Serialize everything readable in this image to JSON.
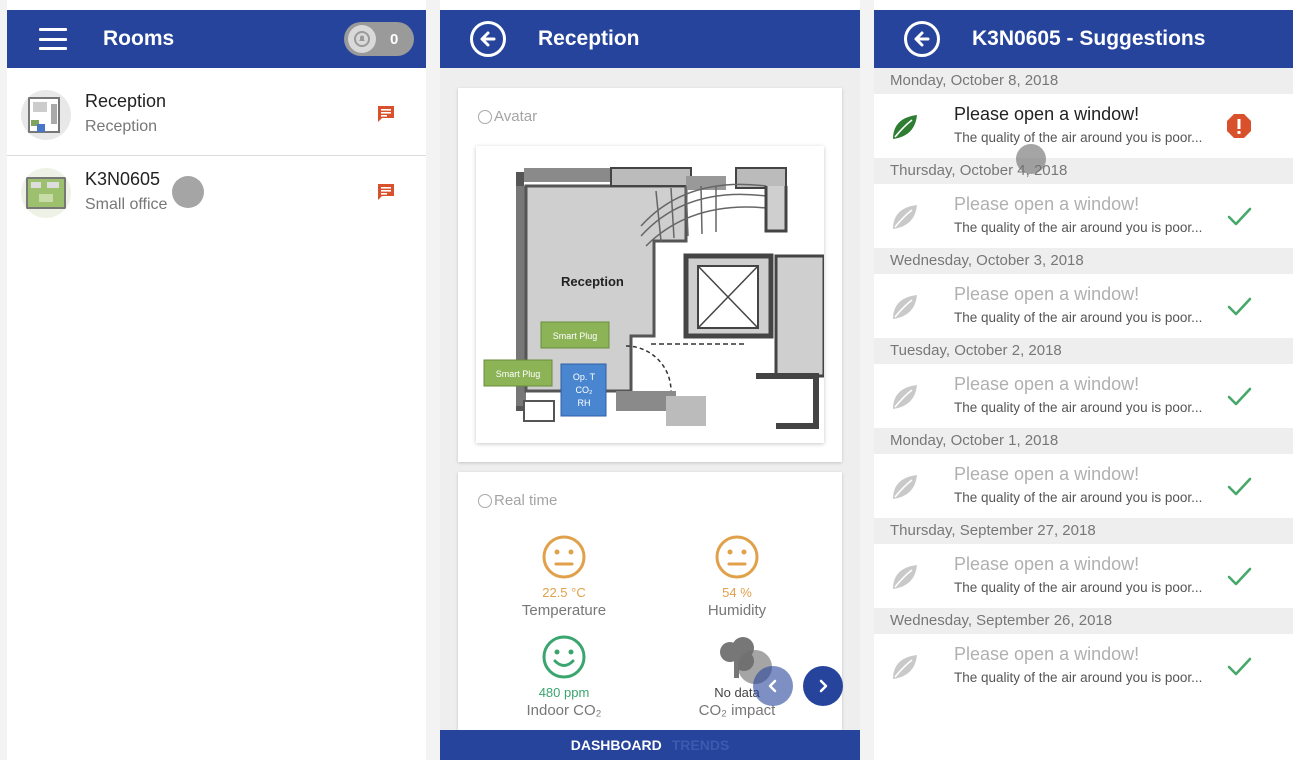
{
  "colors": {
    "primary": "#26449b",
    "accent_red": "#d9512c",
    "leaf_green": "#2e7d32",
    "check_green": "#47a86a",
    "gauge_orange": "#e0a14a",
    "gauge_green": "#3aa56e"
  },
  "rooms_panel": {
    "title": "Rooms",
    "notification_count": "0",
    "rooms": [
      {
        "name": "Reception",
        "type": "Reception",
        "icon": "chat-icon"
      },
      {
        "name": "K3N0605",
        "type": "Small office",
        "icon": "chat-icon"
      }
    ]
  },
  "reception_panel": {
    "title": "Reception",
    "avatar_label": "Avatar",
    "floorplan": {
      "room_label": "Reception",
      "plug1": "Smart Plug",
      "plug2": "Smart Plug",
      "sensor_lines": [
        "Op. T",
        "CO₂",
        "RH"
      ]
    },
    "realtime_label": "Real time",
    "gauges": [
      {
        "value": "22.5 °C",
        "label": "Temperature",
        "mood": "neutral"
      },
      {
        "value": "54 %",
        "label": "Humidity",
        "mood": "neutral"
      },
      {
        "value": "480 ppm",
        "label": "Indoor CO₂",
        "mood": "happy"
      },
      {
        "value": "No data",
        "label": "CO₂ impact",
        "mood": "tree"
      }
    ],
    "tabs": {
      "dashboard": "DASHBOARD",
      "trends": "TRENDS"
    }
  },
  "suggestions_panel": {
    "title": "K3N0605 - Suggestions",
    "groups": [
      {
        "date": "Monday, October 8, 2018",
        "title": "Please open a window!",
        "text": "The quality of the air around you is poor...",
        "status": "alert"
      },
      {
        "date": "Thursday, October 4, 2018",
        "title": "Please open a window!",
        "text": "The quality of the air around you is poor...",
        "status": "done"
      },
      {
        "date": "Wednesday, October 3, 2018",
        "title": "Please open a window!",
        "text": "The quality of the air around you is poor...",
        "status": "done"
      },
      {
        "date": "Tuesday, October 2, 2018",
        "title": "Please open a window!",
        "text": "The quality of the air around you is poor...",
        "status": "done"
      },
      {
        "date": "Monday, October 1, 2018",
        "title": "Please open a window!",
        "text": "The quality of the air around you is poor...",
        "status": "done"
      },
      {
        "date": "Thursday, September 27, 2018",
        "title": "Please open a window!",
        "text": "The quality of the air around you is poor...",
        "status": "done"
      },
      {
        "date": "Wednesday, September 26, 2018",
        "title": "Please open a window!",
        "text": "The quality of the air around you is poor...",
        "status": "done"
      }
    ]
  }
}
